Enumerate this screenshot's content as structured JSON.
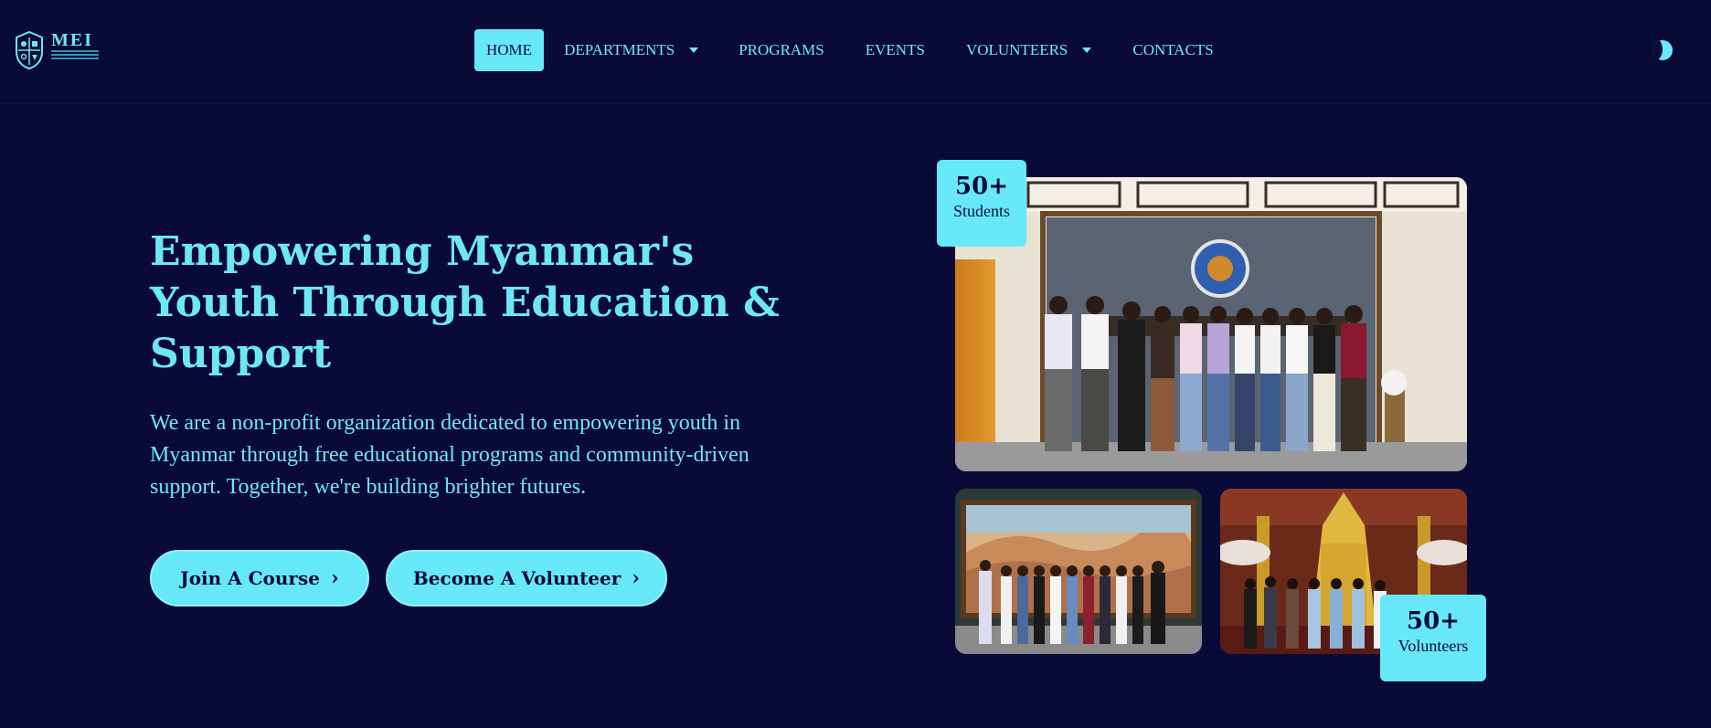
{
  "brand": {
    "logo_text": "MEI"
  },
  "nav": {
    "items": [
      {
        "label": "HOME",
        "active": true,
        "has_dropdown": false
      },
      {
        "label": "DEPARTMENTS",
        "active": false,
        "has_dropdown": true
      },
      {
        "label": "PROGRAMS",
        "active": false,
        "has_dropdown": false
      },
      {
        "label": "EVENTS",
        "active": false,
        "has_dropdown": false
      },
      {
        "label": "VOLUNTEERS",
        "active": false,
        "has_dropdown": true
      },
      {
        "label": "CONTACTS",
        "active": false,
        "has_dropdown": false
      }
    ],
    "theme_toggle_icon": "moon-icon"
  },
  "hero": {
    "title": "Empowering Myanmar's Youth Through Education & Support",
    "description": "We are a non-profit organization dedicated to empowering youth in Myanmar through free educational programs and community-driven support. Together, we're building brighter futures.",
    "buttons": [
      {
        "label": "Join A Course",
        "icon": "chevron-right-icon"
      },
      {
        "label": "Become A Volunteer",
        "icon": "chevron-right-icon"
      }
    ]
  },
  "stats": {
    "students": {
      "value": "50+",
      "label": "Students"
    },
    "volunteers": {
      "value": "50+",
      "label": "Volunteers"
    }
  },
  "colors": {
    "background": "#0a0a38",
    "accent": "#67e8f9",
    "text": "#6ee7f5"
  }
}
